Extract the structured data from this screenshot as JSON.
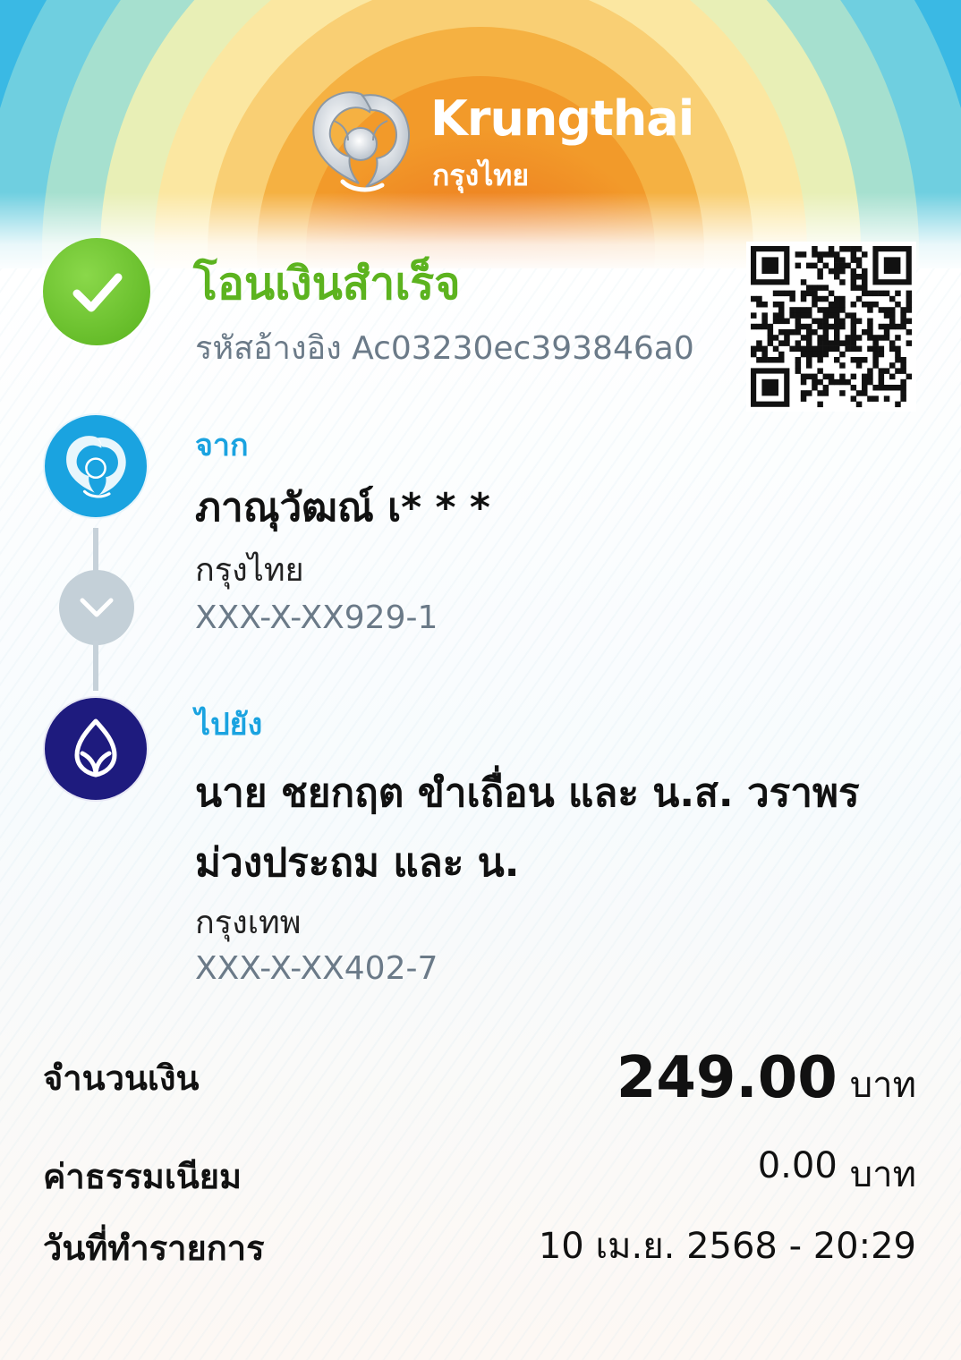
{
  "brand": {
    "name_en": "Krungthai",
    "name_th": "กรุงไทย"
  },
  "status": {
    "title": "โอนเงินสำเร็จ",
    "reference": "รหัสอ้างอิง Ac03230ec393846a0",
    "icon": "check-icon",
    "color": "#5cb31f"
  },
  "from": {
    "label": "จาก",
    "name": "ภาณุวัฒณ์ เ* * *",
    "bank": "กรุงไทย",
    "account": "XXX-X-XX929-1",
    "avatar_color": "#1aa3e0"
  },
  "to": {
    "label": "ไปยัง",
    "name": "นาย ชยกฤต ขำเถื่อน และ น.ส. วราพร ม่วงประถม และ น.",
    "bank": "กรุงเทพ",
    "account": "XXX-X-XX402-7",
    "avatar_color": "#1e1b7e"
  },
  "summary": {
    "amount_label": "จำนวนเงิน",
    "amount": "249.00",
    "amount_unit": "บาท",
    "fee_label": "ค่าธรรมเนียม",
    "fee": "0.00",
    "fee_unit": "บาท",
    "date_label": "วันที่ทำรายการ",
    "datetime": "10 เม.ย. 2568 - 20:29"
  }
}
